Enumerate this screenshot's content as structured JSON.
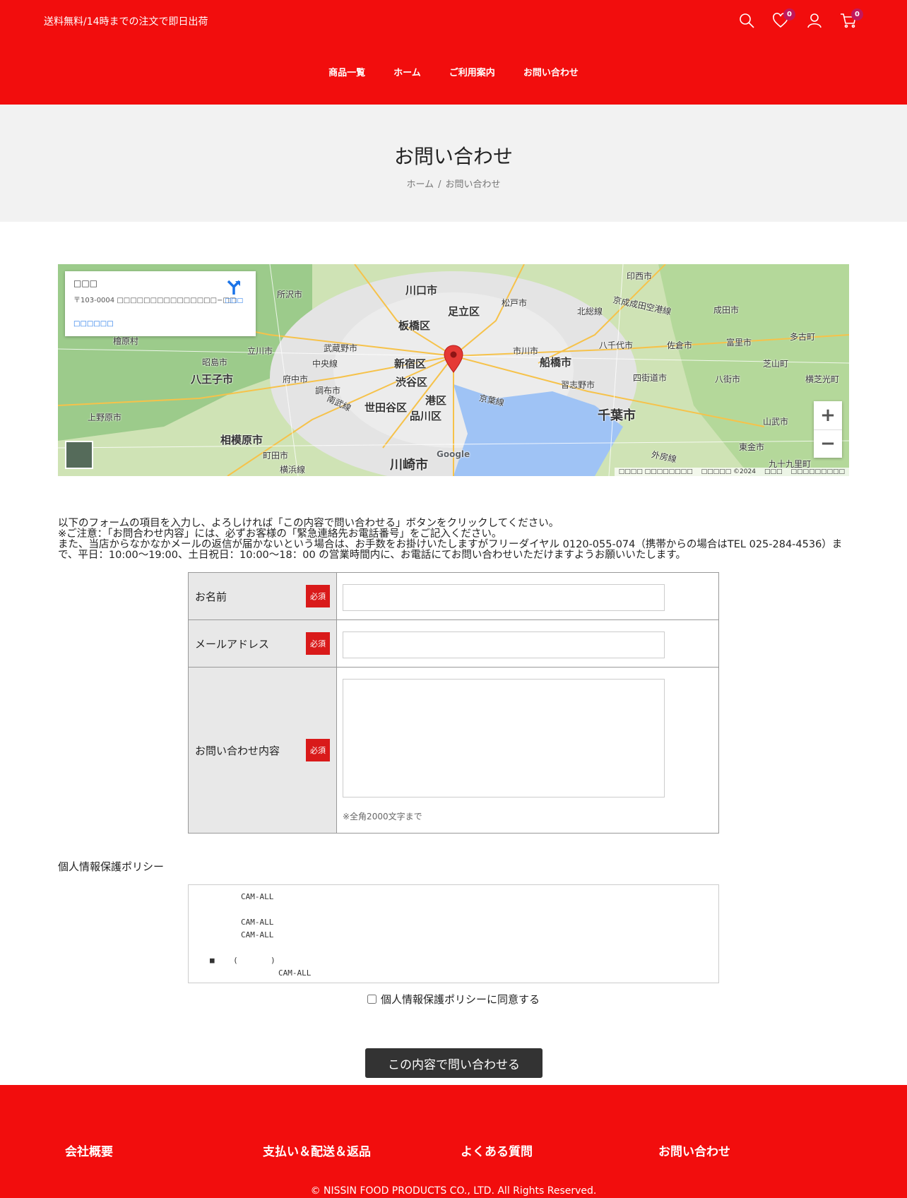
{
  "header": {
    "announcement": "送料無料/14時までの注文で即日出荷",
    "wishlist_count": "0",
    "cart_count": "0",
    "nav": [
      "商品一覧",
      "ホーム",
      "ご利用案内",
      "お問い合わせ"
    ]
  },
  "page": {
    "title": "お問い合わせ",
    "breadcrumb_home": "ホーム",
    "breadcrumb_sep": "/",
    "breadcrumb_current": "お問い合わせ"
  },
  "map": {
    "info_title": "□□□",
    "info_address": "〒103-0004 □□□□□□□□□□□□□□□−□□",
    "info_link": "□□□□□□",
    "directions_label": "□□□",
    "zoom_in": "+",
    "zoom_out": "−",
    "google": "Google",
    "attribution": [
      "□□□□ □□□□□□□□",
      "□□□□□ ©2024",
      "□□□",
      "□□□□□□□□□"
    ],
    "places": [
      "所沢市",
      "川口市",
      "足立区",
      "松戸市",
      "印西市",
      "成田市",
      "板橋区",
      "北総線",
      "京成成田空港線",
      "檜原村",
      "昭島市",
      "立川市",
      "武蔵野市",
      "新宿区",
      "市川市",
      "船橋市",
      "八千代市",
      "佐倉市",
      "富里市",
      "多古町",
      "八王子市",
      "府中市",
      "中央線",
      "渋谷区",
      "習志野市",
      "四街道市",
      "八街市",
      "芝山町",
      "横芝光町",
      "調布市",
      "港区",
      "京葉線",
      "上野原市",
      "世田谷区",
      "品川区",
      "千葉市",
      "山武市",
      "相模原市",
      "東金市",
      "町田市",
      "川崎市",
      "横浜線",
      "外房線",
      "南武線",
      "九十九里町"
    ]
  },
  "intro": {
    "line1": "以下のフォームの項目を入力し、よろしければ「この内容で問い合わせる」ボタンをクリックしてください。",
    "line2": "※ご注意：「お問合わせ内容」には、必ずお客様の「緊急連絡先お電話番号」をご記入ください。",
    "line3": "また、当店からなかなかメールの返信が届かないという場合は、お手数をお掛けいたしますがフリーダイヤル 0120-055-074（携帯からの場合はTEL 025-284-4536）まで、平日：10:00〜19:00、土日祝日：10:00〜18：00 の営業時間内に、お電話にてお問い合わせいただけますようお願いいたします。"
  },
  "form": {
    "required": "必須",
    "name_label": "お名前",
    "email_label": "メールアドレス",
    "message_label": "お問い合わせ内容",
    "message_note": "※全角2000文字まで"
  },
  "policy": {
    "title": "個人情報保護ポリシー",
    "lines": [
      "CAM-ALL",
      "",
      "CAM-ALL",
      "CAM-ALL",
      "",
      "■    (       )",
      "        CAM-ALL"
    ],
    "agree_label": "個人情報保護ポリシーに同意する"
  },
  "submit_label": "この内容で問い合わせる",
  "footer": {
    "cols": [
      "会社概要",
      "支払い＆配送＆返品",
      "よくある質問",
      "お問い合わせ"
    ],
    "copyright": "© NISSIN FOOD PRODUCTS CO., LTD. All Rights Reserved."
  }
}
